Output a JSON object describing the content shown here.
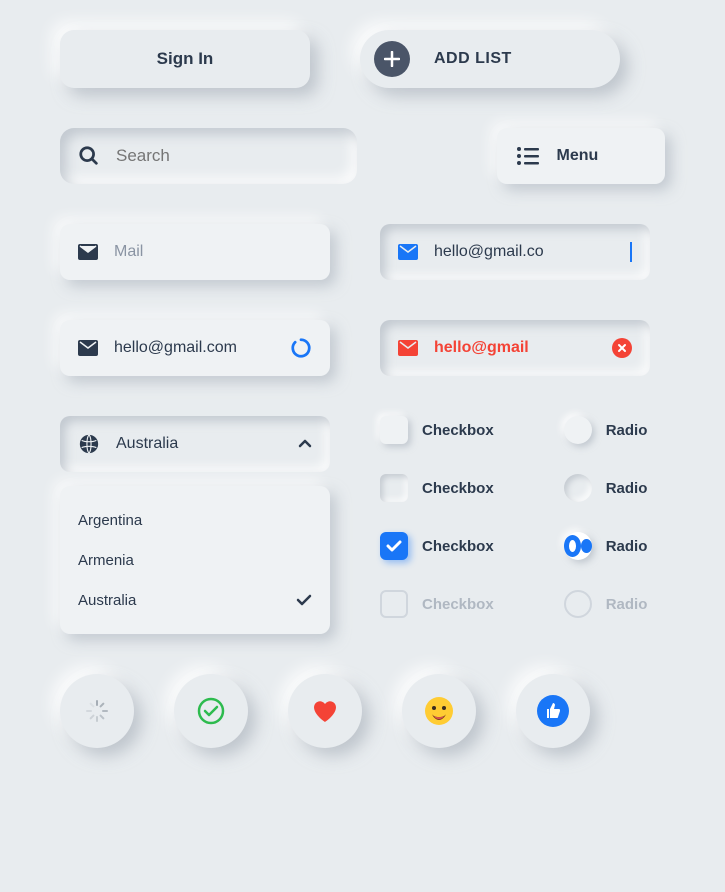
{
  "buttons": {
    "signin": "Sign In",
    "addlist": "ADD LIST",
    "menu": "Menu"
  },
  "search": {
    "placeholder": "Search"
  },
  "mail": {
    "placeholder": "Mail",
    "typing": "hello@gmail.co",
    "loading": "hello@gmail.com",
    "error": "hello@gmail"
  },
  "dropdown": {
    "selected": "Australia",
    "options": [
      "Argentina",
      "Armenia",
      "Australia"
    ]
  },
  "controls": {
    "checkbox_label": "Checkbox",
    "radio_label": "Radio"
  },
  "colors": {
    "primary": "#1976f7",
    "error": "#f44336",
    "text": "#2c3a4d"
  }
}
